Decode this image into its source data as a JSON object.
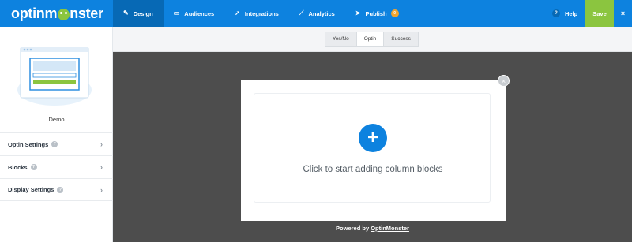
{
  "topbar": {
    "logo": {
      "part1": "optinm",
      "part2": "nster"
    },
    "nav": [
      {
        "label": "Design",
        "icon": "pencil-icon",
        "glyph": "✎"
      },
      {
        "label": "Audiences",
        "icon": "monitor-icon",
        "glyph": "▭"
      },
      {
        "label": "Integrations",
        "icon": "paper-plane-icon",
        "glyph": "➚"
      },
      {
        "label": "Analytics",
        "icon": "line-chart-icon",
        "glyph": "⟋"
      },
      {
        "label": "Publish",
        "icon": "send-icon",
        "glyph": "➤",
        "badge": "0"
      }
    ],
    "help_label": "Help",
    "help_glyph": "?",
    "save_label": "Save",
    "close_glyph": "×"
  },
  "sidebar": {
    "campaign_name": "Demo",
    "menu": [
      {
        "label": "Optin Settings",
        "help": "?",
        "chevron": "›"
      },
      {
        "label": "Blocks",
        "help": "?",
        "chevron": "›"
      },
      {
        "label": "Display Settings",
        "help": "?",
        "chevron": "›"
      }
    ],
    "collapse_glyph": "‹"
  },
  "view_tabs": [
    "Yes/No",
    "Optin",
    "Success"
  ],
  "active_tab": "Optin",
  "canvas": {
    "add_glyph": "+",
    "drop_text": "Click to start adding column blocks",
    "popup_close_glyph": "×",
    "powered_prefix": "Powered by ",
    "powered_link": "OptinMonster"
  },
  "colors": {
    "brand_blue": "#0d82df",
    "active_nav": "#0769b5",
    "save_green": "#8bc53f",
    "canvas_bg": "#4d4d4d",
    "badge_orange": "#f2a42d"
  }
}
